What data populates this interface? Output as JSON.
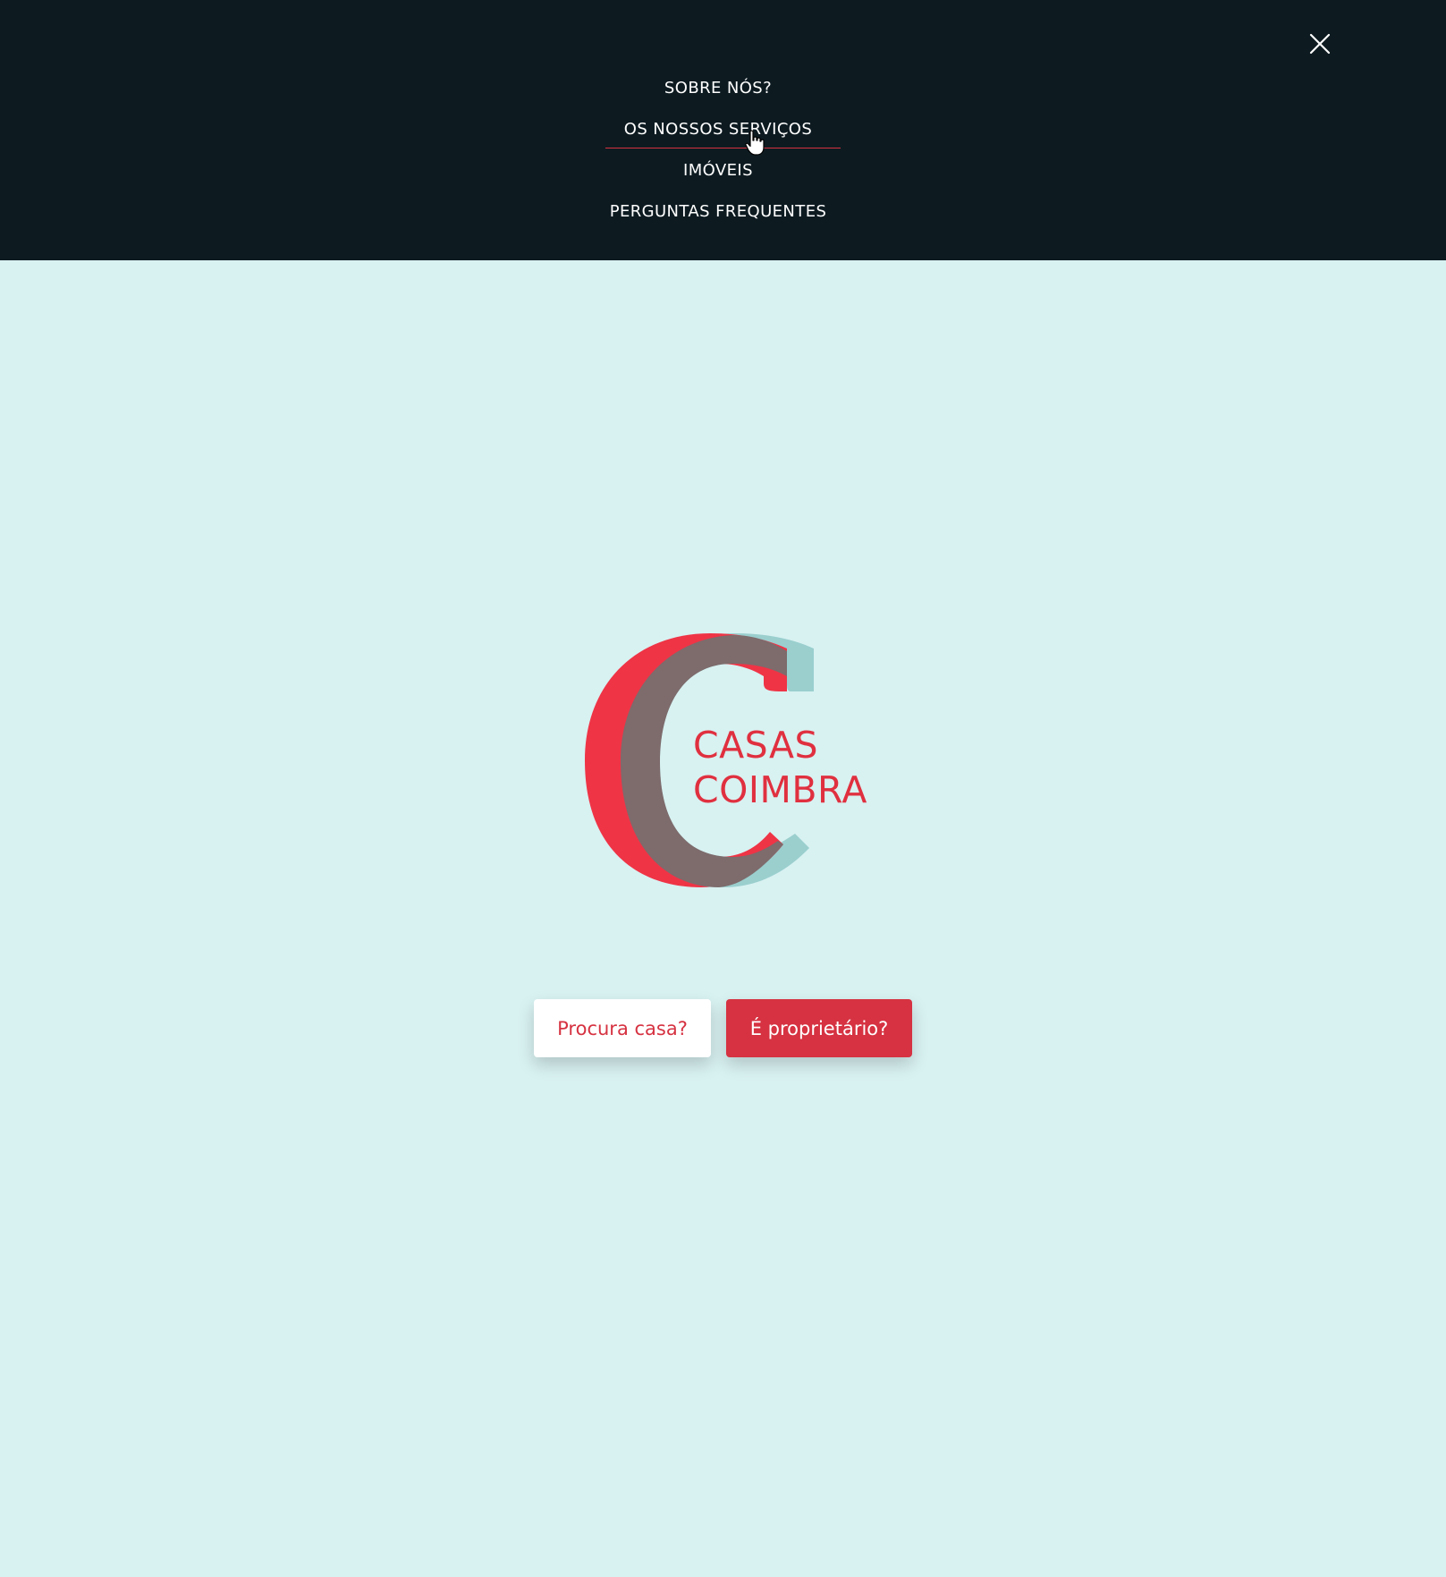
{
  "nav": {
    "items": [
      {
        "label": "SOBRE NÓS?"
      },
      {
        "label": "OS NOSSOS SERVIÇOS"
      },
      {
        "label": "IMÓVEIS"
      },
      {
        "label": "PERGUNTAS FREQUENTES"
      }
    ],
    "active_index": 1,
    "close_icon": "close-icon"
  },
  "logo": {
    "line1": "CASAS",
    "line2": "COIMBRA"
  },
  "hero": {
    "seeker_button": "Procura casa?",
    "owner_button": "É proprietário?"
  },
  "colors": {
    "nav_background": "#0d1b21",
    "page_background": "#d8f1f1",
    "brand_red": "#d63241",
    "brand_teal": "#9acfce",
    "brand_overlap": "#7e6b6c"
  }
}
